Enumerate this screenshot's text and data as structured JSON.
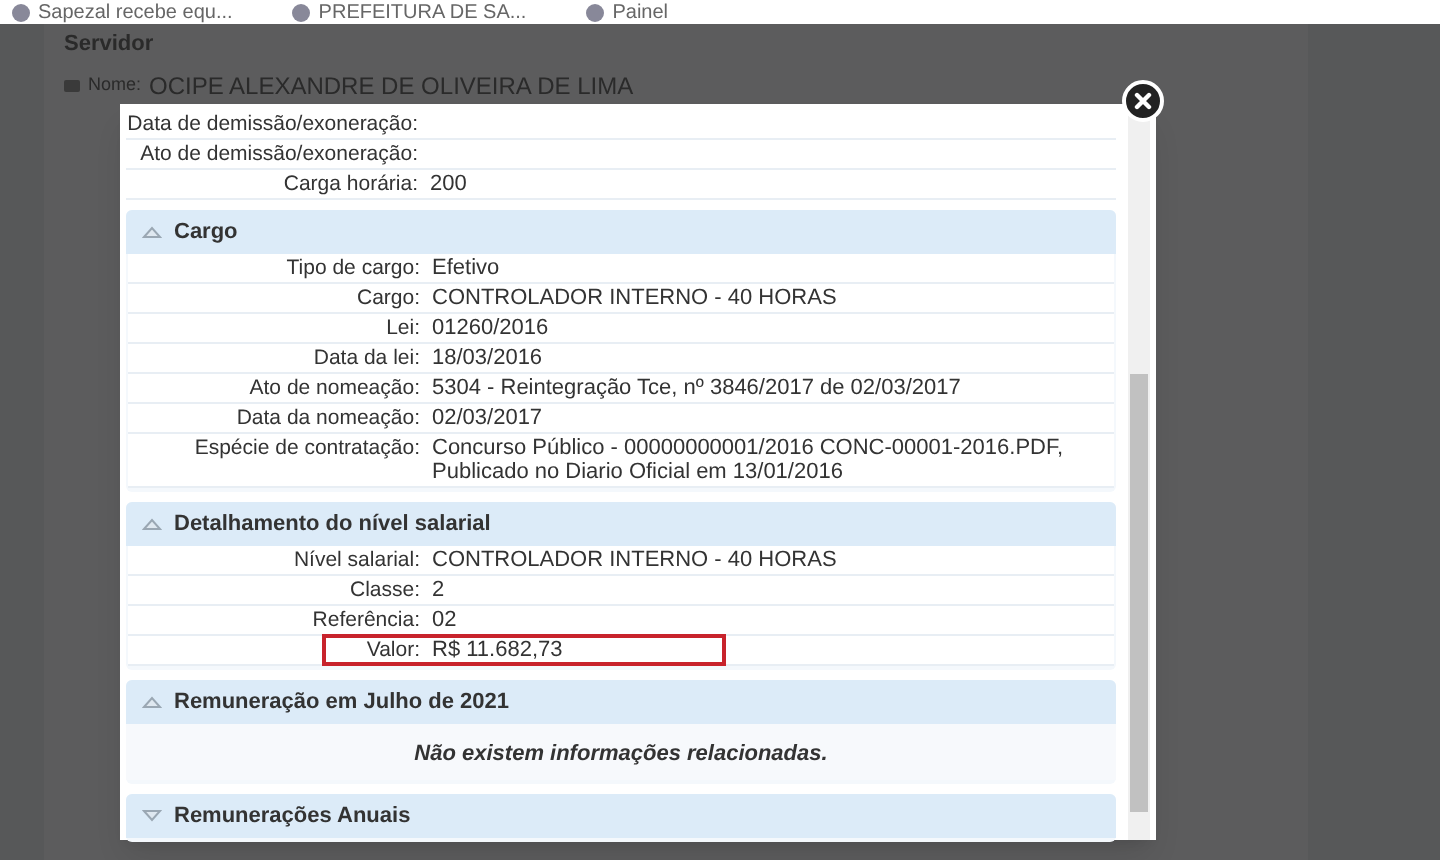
{
  "bookmarks": [
    {
      "label": "Sapezal recebe equ..."
    },
    {
      "label": "PREFEITURA DE SA..."
    },
    {
      "label": "Painel"
    }
  ],
  "page": {
    "title": "Servidor",
    "name_label": "Nome:",
    "name_value": "OCIPE ALEXANDRE DE OLIVEIRA DE LIMA"
  },
  "modal": {
    "top_rows": [
      {
        "label": "Data de demissão/exoneração:",
        "value": ""
      },
      {
        "label": "Ato de demissão/exoneração:",
        "value": ""
      },
      {
        "label": "Carga horária:",
        "value": "200"
      }
    ],
    "sections": [
      {
        "title": "Cargo",
        "expanded": true,
        "rows": [
          {
            "label": "Tipo de cargo:",
            "value": "Efetivo",
            "highlighted": false
          },
          {
            "label": "Cargo:",
            "value": "CONTROLADOR INTERNO - 40 HORAS",
            "highlighted": false
          },
          {
            "label": "Lei:",
            "value": "01260/2016",
            "highlighted": false
          },
          {
            "label": "Data da lei:",
            "value": "18/03/2016",
            "highlighted": false
          },
          {
            "label": "Ato de nomeação:",
            "value": "5304 - Reintegração Tce, nº 3846/2017 de 02/03/2017",
            "highlighted": false
          },
          {
            "label": "Data da nomeação:",
            "value": "02/03/2017",
            "highlighted": false
          },
          {
            "label": "Espécie de contratação:",
            "value": "Concurso Público - 00000000001/2016 CONC-00001-2016.PDF, Publicado no Diario Oficial em 13/01/2016",
            "highlighted": false
          }
        ]
      },
      {
        "title": "Detalhamento do nível salarial",
        "expanded": true,
        "rows": [
          {
            "label": "Nível salarial:",
            "value": "CONTROLADOR INTERNO - 40 HORAS",
            "highlighted": false
          },
          {
            "label": "Classe:",
            "value": "2",
            "highlighted": false
          },
          {
            "label": "Referência:",
            "value": "02",
            "highlighted": false
          },
          {
            "label": "Valor:",
            "value": "R$ 11.682,73",
            "highlighted": true
          }
        ]
      },
      {
        "title": "Remuneração em Julho de 2021",
        "expanded": true,
        "message": "Não existem informações relacionadas."
      },
      {
        "title": "Remunerações Anuais",
        "expanded": false
      }
    ]
  }
}
